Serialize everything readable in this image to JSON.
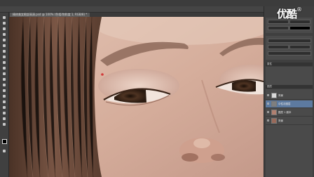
{
  "app": {
    "name": "Adobe Photoshop"
  },
  "document_tab": {
    "label": "精修美女眼部高清.psd @ 100% (色相/饱和度 1, RGB/8) *"
  },
  "watermark": {
    "text": "优酷"
  },
  "panels": {
    "properties_title": "属性",
    "layers_title": "图层"
  },
  "layers": [
    {
      "name": "背景",
      "visible": true,
      "selected": false,
      "thumb": "#d9d9d9"
    },
    {
      "name": "中性灰图层",
      "visible": true,
      "selected": true,
      "thumb": "#7f7f7f"
    },
    {
      "name": "图层 1 副本",
      "visible": true,
      "selected": false,
      "thumb": "#b08070"
    },
    {
      "name": "背景",
      "visible": true,
      "selected": false,
      "thumb": "#9a6a5a"
    }
  ],
  "colors": {
    "ui_dark": "#3f3f3f",
    "selection": "#5d7aa0",
    "skin": "#d6b0a0",
    "hair": "#6b4a3a"
  }
}
